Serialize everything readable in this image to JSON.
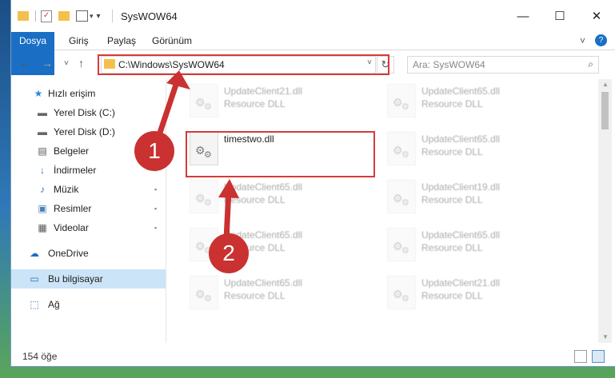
{
  "window": {
    "title": "SysWOW64",
    "controls": {
      "minimize": "—",
      "maximize": "☐",
      "close": "✕"
    }
  },
  "ribbon": {
    "tabs": [
      "Dosya",
      "Giriş",
      "Paylaş",
      "Görünüm"
    ],
    "collapse_icon": "˅",
    "help_icon": "?"
  },
  "address": {
    "back_icon": "←",
    "forward_icon": "→",
    "recent_icon": "˅",
    "up_icon": "↑",
    "path": "C:\\Windows\\SysWOW64",
    "dropdown_icon": "˅",
    "refresh_icon": "↻",
    "search_placeholder": "Ara: SysWOW64",
    "search_icon": "⌕"
  },
  "sidebar": {
    "items": [
      {
        "label": "Hızlı erişim",
        "icon": "★",
        "pinned": false,
        "selected": false
      },
      {
        "label": "Yerel Disk (C:)",
        "icon": "▬",
        "pinned": false,
        "selected": false
      },
      {
        "label": "Yerel Disk (D:)",
        "icon": "▬",
        "pinned": false,
        "selected": false
      },
      {
        "label": "Belgeler",
        "icon": "▤",
        "pinned": true,
        "selected": false
      },
      {
        "label": "İndirmeler",
        "icon": "↓",
        "pinned": true,
        "selected": false
      },
      {
        "label": "Müzik",
        "icon": "♪",
        "pinned": true,
        "selected": false
      },
      {
        "label": "Resimler",
        "icon": "▣",
        "pinned": true,
        "selected": false
      },
      {
        "label": "Videolar",
        "icon": "▦",
        "pinned": true,
        "selected": false
      },
      {
        "label": "OneDrive",
        "icon": "☁",
        "pinned": false,
        "selected": false
      },
      {
        "label": "Bu bilgisayar",
        "icon": "▭",
        "pinned": false,
        "selected": true
      },
      {
        "label": "Ağ",
        "icon": "⬚",
        "pinned": false,
        "selected": false
      }
    ],
    "pin_icon": "📌"
  },
  "files": [
    {
      "name": "UpdateClient21.dll",
      "type": "Resource DLL",
      "highlighted": false
    },
    {
      "name": "UpdateClient65.dll",
      "type": "Resource DLL",
      "highlighted": false
    },
    {
      "name": "timestwo.dll",
      "type": "",
      "highlighted": true
    },
    {
      "name": "UpdateClient65.dll",
      "type": "Resource DLL",
      "highlighted": false
    },
    {
      "name": "UpdateClient65.dll",
      "type": "Resource DLL",
      "highlighted": false
    },
    {
      "name": "UpdateClient19.dll",
      "type": "Resource DLL",
      "highlighted": false
    },
    {
      "name": "UpdateClient65.dll",
      "type": "Resource DLL",
      "highlighted": false
    },
    {
      "name": "UpdateClient65.dll",
      "type": "Resource DLL",
      "highlighted": false
    },
    {
      "name": "UpdateClient65.dll",
      "type": "Resource DLL",
      "highlighted": false
    },
    {
      "name": "UpdateClient21.dll",
      "type": "Resource DLL",
      "highlighted": false
    }
  ],
  "status": {
    "count": "154 öğe"
  },
  "annotations": [
    {
      "number": "1",
      "color": "#ca3131"
    },
    {
      "number": "2",
      "color": "#ca3131"
    }
  ],
  "colors": {
    "accent": "#1a6fc4",
    "highlight": "#d63a3a",
    "selected": "#cce4f7"
  }
}
